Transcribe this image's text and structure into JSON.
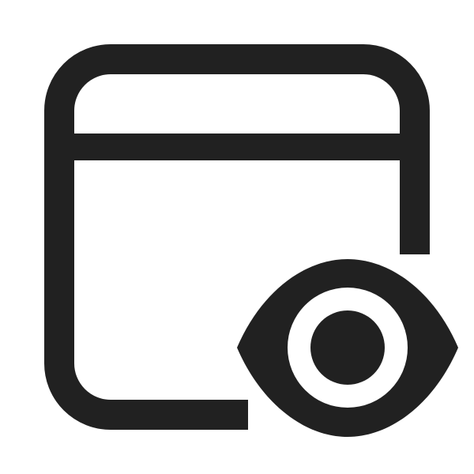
{
  "icon": {
    "name": "window-eye-icon",
    "parts": [
      "window-frame",
      "title-bar-divider",
      "eye-outline",
      "eye-iris-ring",
      "eye-pupil"
    ],
    "colors": {
      "stroke": "#212121",
      "background": "#ffffff"
    }
  }
}
